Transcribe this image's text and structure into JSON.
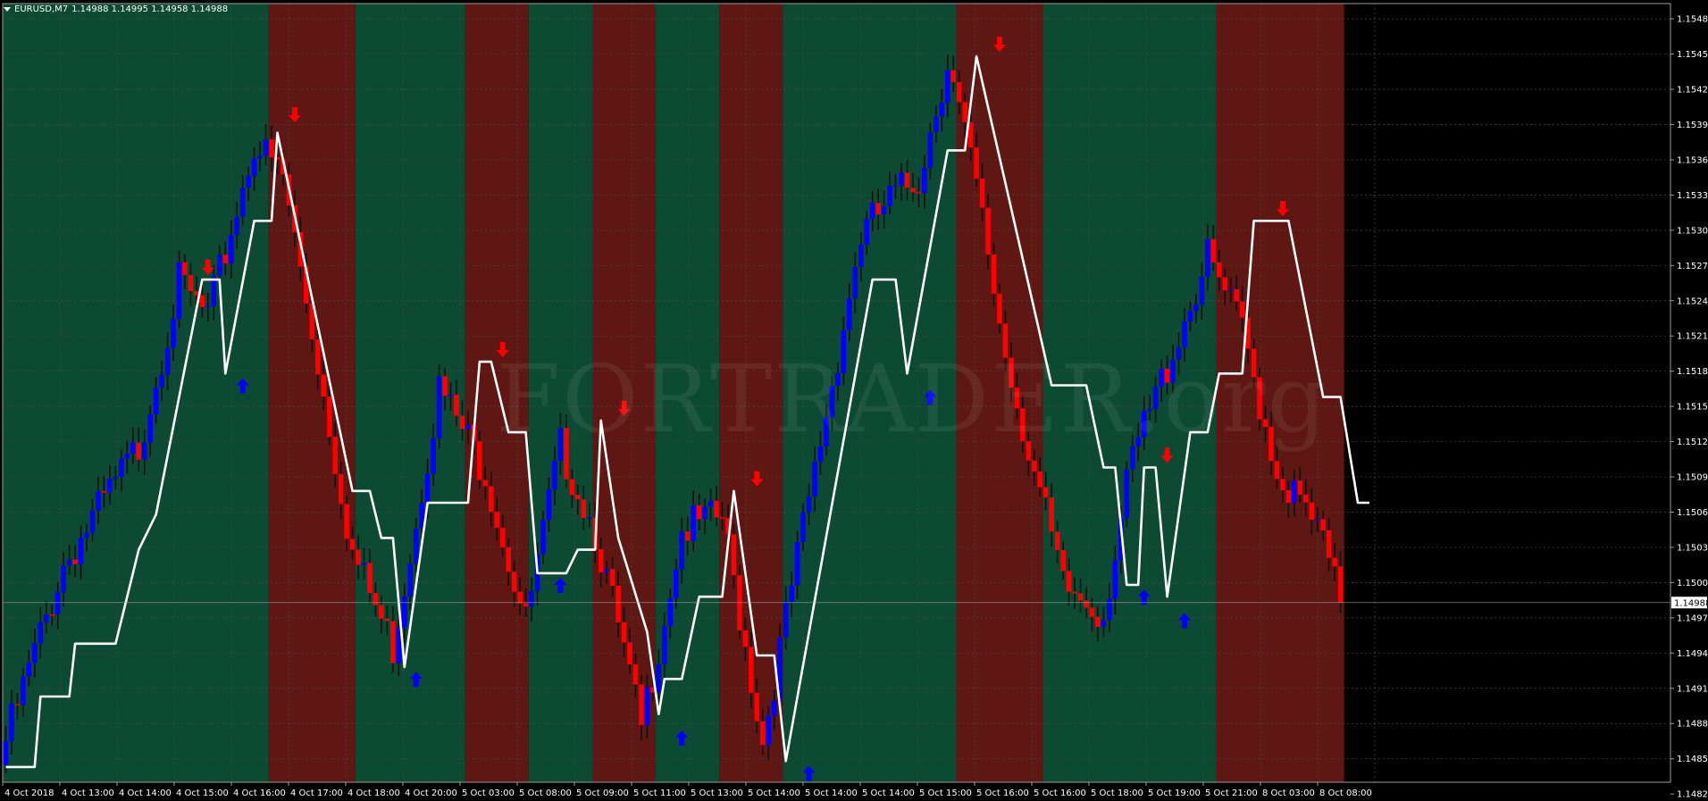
{
  "header": {
    "symbol": "EURUSD,M7",
    "ohlc": "1.14988 1.14995 1.14958 1.14988"
  },
  "watermark": "FORTRADER.org",
  "colors": {
    "background": "#000000",
    "bull_zone": "#0c4a33",
    "bear_zone": "#5e1712",
    "bull_candle": "#0000ff",
    "bear_candle": "#ff0000",
    "trend_line": "#ffffff",
    "axis_text": "#ffffff",
    "price_tag_bg": "#ffffff",
    "price_tag_text": "#000000",
    "grid": "#4a4a4a"
  },
  "chart_data": {
    "type": "candlestick",
    "symbol": "EURUSD",
    "timeframe": "M7",
    "ylim": [
      1.14835,
      1.15498
    ],
    "y_ticks": [
      "1.15485",
      "1.15455",
      "1.15425",
      "1.15395",
      "1.15365",
      "1.15335",
      "1.15305",
      "1.15275",
      "1.15245",
      "1.15215",
      "1.15185",
      "1.15155",
      "1.15125",
      "1.15095",
      "1.15065",
      "1.15035",
      "1.15005",
      "1.14975",
      "1.14945",
      "1.14915",
      "1.14885",
      "1.14855",
      "1.14825"
    ],
    "x_ticks": [
      "4 Oct 2018",
      "4 Oct 13:00",
      "4 Oct 14:00",
      "4 Oct 15:00",
      "4 Oct 16:00",
      "4 Oct 17:00",
      "4 Oct 18:00",
      "4 Oct 20:00",
      "5 Oct 03:00",
      "5 Oct 08:00",
      "5 Oct 09:00",
      "5 Oct 11:00",
      "5 Oct 13:00",
      "5 Oct 14:00",
      "5 Oct 14:00",
      "5 Oct 14:00",
      "5 Oct 15:00",
      "5 Oct 16:00",
      "5 Oct 16:00",
      "5 Oct 18:00",
      "5 Oct 19:00",
      "5 Oct 21:00",
      "8 Oct 03:00",
      "8 Oct 08:00"
    ],
    "bar_count": 232,
    "last_price": "1.14988",
    "grid": true,
    "trend_zones": [
      {
        "from": 0,
        "to": 45,
        "trend": "bull"
      },
      {
        "from": 46,
        "to": 60,
        "trend": "bear"
      },
      {
        "from": 61,
        "to": 79,
        "trend": "bull"
      },
      {
        "from": 80,
        "to": 90,
        "trend": "bear"
      },
      {
        "from": 91,
        "to": 101,
        "trend": "bull"
      },
      {
        "from": 102,
        "to": 112,
        "trend": "bear"
      },
      {
        "from": 113,
        "to": 123,
        "trend": "bull"
      },
      {
        "from": 124,
        "to": 134,
        "trend": "bear"
      },
      {
        "from": 135,
        "to": 164,
        "trend": "bull"
      },
      {
        "from": 165,
        "to": 179,
        "trend": "bear"
      },
      {
        "from": 180,
        "to": 209,
        "trend": "bull"
      },
      {
        "from": 210,
        "to": 231,
        "trend": "bear"
      }
    ],
    "price_path": [
      [
        0,
        1.1487
      ],
      [
        10,
        1.1502
      ],
      [
        23,
        1.1512
      ],
      [
        30,
        1.1526
      ],
      [
        35,
        1.1523
      ],
      [
        43,
        1.1538
      ],
      [
        48,
        1.1535
      ],
      [
        53,
        1.1522
      ],
      [
        60,
        1.1503
      ],
      [
        67,
        1.1495
      ],
      [
        75,
        1.1517
      ],
      [
        83,
        1.151
      ],
      [
        90,
        1.1497
      ],
      [
        96,
        1.1512
      ],
      [
        102,
        1.1505
      ],
      [
        110,
        1.1488
      ],
      [
        117,
        1.1505
      ],
      [
        124,
        1.1506
      ],
      [
        131,
        1.1487
      ],
      [
        136,
        1.15
      ],
      [
        148,
        1.153
      ],
      [
        153,
        1.1533
      ],
      [
        158,
        1.1535
      ],
      [
        163,
        1.1545
      ],
      [
        168,
        1.1534
      ],
      [
        173,
        1.152
      ],
      [
        178,
        1.151
      ],
      [
        183,
        1.15
      ],
      [
        190,
        1.1498
      ],
      [
        195,
        1.1511
      ],
      [
        204,
        1.1523
      ],
      [
        208,
        1.1528
      ],
      [
        214,
        1.1522
      ],
      [
        220,
        1.151
      ],
      [
        227,
        1.1505
      ],
      [
        231,
        1.14988
      ]
    ],
    "trend_line": [
      [
        0,
        1.14848
      ],
      [
        5,
        1.14848
      ],
      [
        6,
        1.14908
      ],
      [
        11,
        1.14908
      ],
      [
        12,
        1.14953
      ],
      [
        19,
        1.14953
      ],
      [
        23,
        1.15033
      ],
      [
        26,
        1.15063
      ],
      [
        30,
        1.15163
      ],
      [
        34,
        1.15263
      ],
      [
        37,
        1.15263
      ],
      [
        38,
        1.15183
      ],
      [
        43,
        1.15313
      ],
      [
        46,
        1.15313
      ],
      [
        47,
        1.15388
      ],
      [
        60,
        1.15083
      ],
      [
        63,
        1.15083
      ],
      [
        65,
        1.15043
      ],
      [
        67,
        1.15043
      ],
      [
        69,
        1.14933
      ],
      [
        73,
        1.15073
      ],
      [
        80,
        1.15073
      ],
      [
        82,
        1.15193
      ],
      [
        84,
        1.15193
      ],
      [
        87,
        1.15133
      ],
      [
        90,
        1.15133
      ],
      [
        92,
        1.15013
      ],
      [
        97,
        1.15013
      ],
      [
        99,
        1.15033
      ],
      [
        102,
        1.15033
      ],
      [
        103,
        1.15143
      ],
      [
        106,
        1.15043
      ],
      [
        111,
        1.14963
      ],
      [
        113,
        1.14893
      ],
      [
        114,
        1.14923
      ],
      [
        117,
        1.14923
      ],
      [
        120,
        1.14993
      ],
      [
        124,
        1.14993
      ],
      [
        126,
        1.15083
      ],
      [
        130,
        1.14943
      ],
      [
        133,
        1.14943
      ],
      [
        135,
        1.14853
      ],
      [
        150,
        1.15263
      ],
      [
        154,
        1.15263
      ],
      [
        156,
        1.15183
      ],
      [
        163,
        1.15373
      ],
      [
        166,
        1.15373
      ],
      [
        168,
        1.15453
      ],
      [
        181,
        1.15173
      ],
      [
        187,
        1.15173
      ],
      [
        190,
        1.15103
      ],
      [
        192,
        1.15103
      ],
      [
        194,
        1.15003
      ],
      [
        196,
        1.15003
      ],
      [
        197,
        1.15103
      ],
      [
        199,
        1.15103
      ],
      [
        201,
        1.14993
      ],
      [
        205,
        1.15133
      ],
      [
        208,
        1.15133
      ],
      [
        210,
        1.15183
      ],
      [
        214,
        1.15183
      ],
      [
        216,
        1.15313
      ],
      [
        222,
        1.15313
      ],
      [
        228,
        1.15163
      ],
      [
        231,
        1.15163
      ],
      [
        234,
        1.15073
      ],
      [
        236,
        1.15073
      ]
    ],
    "signals": [
      {
        "bar": 35,
        "type": "sell",
        "price": 1.15273
      },
      {
        "bar": 41,
        "type": "buy",
        "price": 1.15173
      },
      {
        "bar": 50,
        "type": "sell",
        "price": 1.15403
      },
      {
        "bar": 71,
        "type": "buy",
        "price": 1.14923
      },
      {
        "bar": 86,
        "type": "sell",
        "price": 1.15203
      },
      {
        "bar": 96,
        "type": "buy",
        "price": 1.15003
      },
      {
        "bar": 107,
        "type": "sell",
        "price": 1.15153
      },
      {
        "bar": 117,
        "type": "buy",
        "price": 1.14873
      },
      {
        "bar": 130,
        "type": "sell",
        "price": 1.15093
      },
      {
        "bar": 139,
        "type": "buy",
        "price": 1.14843
      },
      {
        "bar": 160,
        "type": "buy",
        "price": 1.15163
      },
      {
        "bar": 172,
        "type": "sell",
        "price": 1.15463
      },
      {
        "bar": 197,
        "type": "buy",
        "price": 1.14993
      },
      {
        "bar": 201,
        "type": "sell",
        "price": 1.15113
      },
      {
        "bar": 204,
        "type": "buy",
        "price": 1.14973
      },
      {
        "bar": 221,
        "type": "sell",
        "price": 1.15323
      }
    ]
  }
}
